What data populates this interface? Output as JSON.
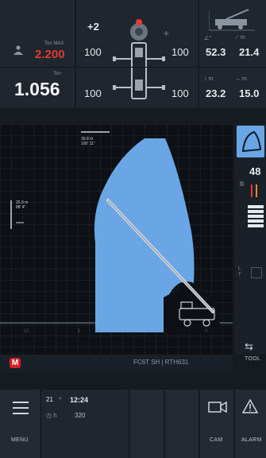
{
  "load": {
    "ton_max_label": "Ton MAX",
    "ton_max_value": "2.200",
    "ton_label": "Ton",
    "ton_value": "1.056"
  },
  "stabilizers": {
    "level": "+2",
    "left_top": "100",
    "right_top": "100",
    "left_bottom": "100",
    "right_bottom": "100"
  },
  "boom": {
    "angle_value": "52.3",
    "length_value": "21.4",
    "height_value": "23.2",
    "radius_value": "15.0",
    "unit_m": "m"
  },
  "work_area": {
    "top_marker": "30.8 m",
    "top_marker_sub": "100' 11\"",
    "left_marker": "26.9 m",
    "left_marker_sub": "88' 4\""
  },
  "side": {
    "percent": "48"
  },
  "footer": {
    "model": "FC6T SH | RTH631"
  },
  "tool": {
    "label": "TOOL"
  },
  "bottom": {
    "menu_label": "MENU",
    "status_num": "21",
    "time": "12:24",
    "hours": "320",
    "cam_label": "CAM",
    "alarm_label": "ALARM"
  },
  "colors": {
    "accent_blue": "#6aa6e6",
    "alert_red": "#e53a33",
    "brand_red": "#d21f26"
  }
}
